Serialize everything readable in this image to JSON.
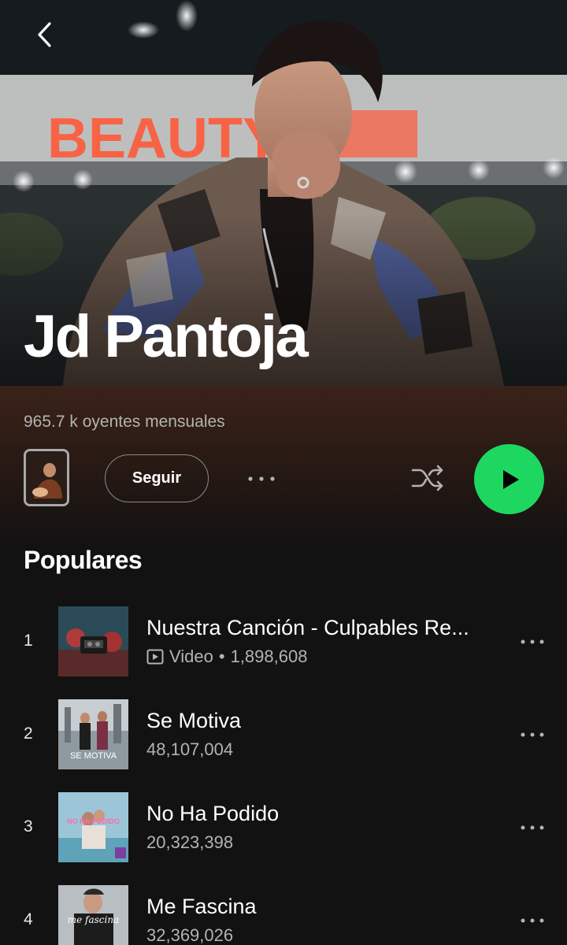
{
  "artist": {
    "name": "Jd Pantoja",
    "listeners": "965.7 k oyentes mensuales",
    "hero_sign_text": "BEAUTY"
  },
  "actions": {
    "follow_label": "Seguir"
  },
  "colors": {
    "accent": "#1ed760",
    "background": "#121212",
    "secondary_text": "#b3b3b3"
  },
  "icons": {
    "back": "chevron-left-icon",
    "more": "more-horizontal-icon",
    "shuffle": "shuffle-icon",
    "play": "play-icon",
    "video": "video-icon"
  },
  "popular": {
    "title": "Populares",
    "tracks": [
      {
        "number": "1",
        "title": "Nuestra Canción - Culpables Re...",
        "type_label": "Video",
        "separator": "•",
        "plays": "1,898,608"
      },
      {
        "number": "2",
        "title": "Se Motiva",
        "plays": "48,107,004",
        "cover_text": "SE MOTIVA"
      },
      {
        "number": "3",
        "title": "No Ha Podido",
        "plays": "20,323,398",
        "cover_text": "NO HA PODIDO"
      },
      {
        "number": "4",
        "title": "Me Fascina",
        "plays": "32,369,026",
        "cover_text": "me fascina"
      }
    ]
  }
}
